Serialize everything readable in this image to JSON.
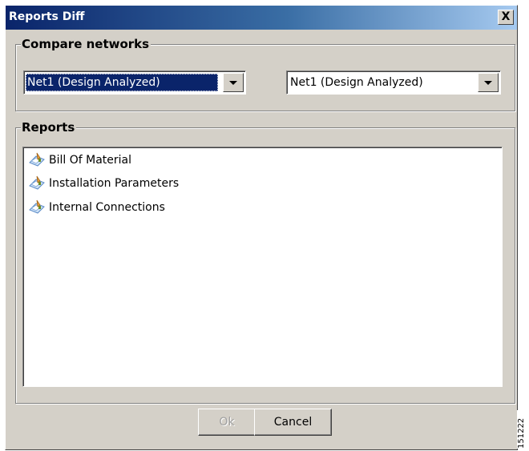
{
  "window": {
    "title": "Reports Diff",
    "close_label": "X"
  },
  "compare_networks": {
    "legend": "Compare networks",
    "left_selected": "Net1 (Design Analyzed)",
    "right_selected": "Net1 (Design Analyzed)"
  },
  "reports": {
    "legend": "Reports",
    "items": [
      {
        "label": "Bill Of Material",
        "icon": "report-icon"
      },
      {
        "label": "Installation Parameters",
        "icon": "report-icon"
      },
      {
        "label": "Internal Connections",
        "icon": "report-icon"
      }
    ]
  },
  "buttons": {
    "ok": "Ok",
    "cancel": "Cancel"
  },
  "figure_number": "151222",
  "colors": {
    "title_start": "#0a246a",
    "title_end": "#a6caf0",
    "dialog_bg": "#d4d0c8",
    "selection": "#0a246a"
  }
}
